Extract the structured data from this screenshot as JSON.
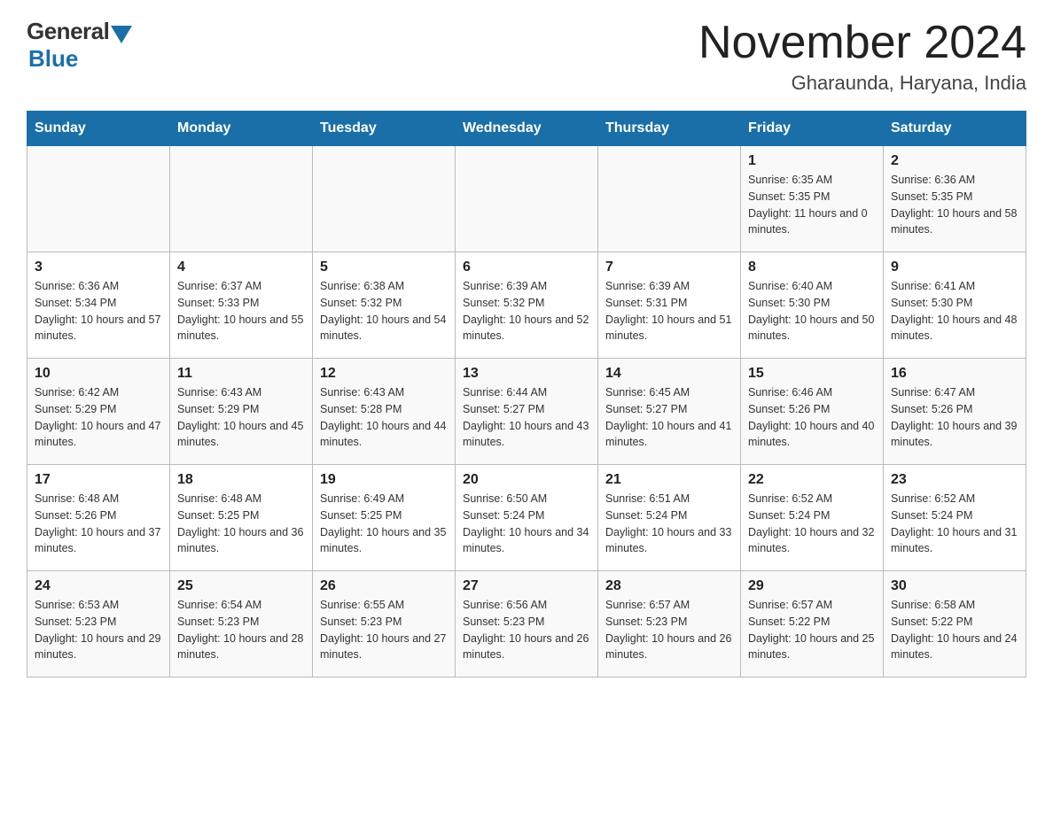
{
  "logo": {
    "general": "General",
    "blue": "Blue"
  },
  "title": "November 2024",
  "subtitle": "Gharaunda, Haryana, India",
  "headers": [
    "Sunday",
    "Monday",
    "Tuesday",
    "Wednesday",
    "Thursday",
    "Friday",
    "Saturday"
  ],
  "weeks": [
    [
      {
        "day": "",
        "info": ""
      },
      {
        "day": "",
        "info": ""
      },
      {
        "day": "",
        "info": ""
      },
      {
        "day": "",
        "info": ""
      },
      {
        "day": "",
        "info": ""
      },
      {
        "day": "1",
        "info": "Sunrise: 6:35 AM\nSunset: 5:35 PM\nDaylight: 11 hours and 0 minutes."
      },
      {
        "day": "2",
        "info": "Sunrise: 6:36 AM\nSunset: 5:35 PM\nDaylight: 10 hours and 58 minutes."
      }
    ],
    [
      {
        "day": "3",
        "info": "Sunrise: 6:36 AM\nSunset: 5:34 PM\nDaylight: 10 hours and 57 minutes."
      },
      {
        "day": "4",
        "info": "Sunrise: 6:37 AM\nSunset: 5:33 PM\nDaylight: 10 hours and 55 minutes."
      },
      {
        "day": "5",
        "info": "Sunrise: 6:38 AM\nSunset: 5:32 PM\nDaylight: 10 hours and 54 minutes."
      },
      {
        "day": "6",
        "info": "Sunrise: 6:39 AM\nSunset: 5:32 PM\nDaylight: 10 hours and 52 minutes."
      },
      {
        "day": "7",
        "info": "Sunrise: 6:39 AM\nSunset: 5:31 PM\nDaylight: 10 hours and 51 minutes."
      },
      {
        "day": "8",
        "info": "Sunrise: 6:40 AM\nSunset: 5:30 PM\nDaylight: 10 hours and 50 minutes."
      },
      {
        "day": "9",
        "info": "Sunrise: 6:41 AM\nSunset: 5:30 PM\nDaylight: 10 hours and 48 minutes."
      }
    ],
    [
      {
        "day": "10",
        "info": "Sunrise: 6:42 AM\nSunset: 5:29 PM\nDaylight: 10 hours and 47 minutes."
      },
      {
        "day": "11",
        "info": "Sunrise: 6:43 AM\nSunset: 5:29 PM\nDaylight: 10 hours and 45 minutes."
      },
      {
        "day": "12",
        "info": "Sunrise: 6:43 AM\nSunset: 5:28 PM\nDaylight: 10 hours and 44 minutes."
      },
      {
        "day": "13",
        "info": "Sunrise: 6:44 AM\nSunset: 5:27 PM\nDaylight: 10 hours and 43 minutes."
      },
      {
        "day": "14",
        "info": "Sunrise: 6:45 AM\nSunset: 5:27 PM\nDaylight: 10 hours and 41 minutes."
      },
      {
        "day": "15",
        "info": "Sunrise: 6:46 AM\nSunset: 5:26 PM\nDaylight: 10 hours and 40 minutes."
      },
      {
        "day": "16",
        "info": "Sunrise: 6:47 AM\nSunset: 5:26 PM\nDaylight: 10 hours and 39 minutes."
      }
    ],
    [
      {
        "day": "17",
        "info": "Sunrise: 6:48 AM\nSunset: 5:26 PM\nDaylight: 10 hours and 37 minutes."
      },
      {
        "day": "18",
        "info": "Sunrise: 6:48 AM\nSunset: 5:25 PM\nDaylight: 10 hours and 36 minutes."
      },
      {
        "day": "19",
        "info": "Sunrise: 6:49 AM\nSunset: 5:25 PM\nDaylight: 10 hours and 35 minutes."
      },
      {
        "day": "20",
        "info": "Sunrise: 6:50 AM\nSunset: 5:24 PM\nDaylight: 10 hours and 34 minutes."
      },
      {
        "day": "21",
        "info": "Sunrise: 6:51 AM\nSunset: 5:24 PM\nDaylight: 10 hours and 33 minutes."
      },
      {
        "day": "22",
        "info": "Sunrise: 6:52 AM\nSunset: 5:24 PM\nDaylight: 10 hours and 32 minutes."
      },
      {
        "day": "23",
        "info": "Sunrise: 6:52 AM\nSunset: 5:24 PM\nDaylight: 10 hours and 31 minutes."
      }
    ],
    [
      {
        "day": "24",
        "info": "Sunrise: 6:53 AM\nSunset: 5:23 PM\nDaylight: 10 hours and 29 minutes."
      },
      {
        "day": "25",
        "info": "Sunrise: 6:54 AM\nSunset: 5:23 PM\nDaylight: 10 hours and 28 minutes."
      },
      {
        "day": "26",
        "info": "Sunrise: 6:55 AM\nSunset: 5:23 PM\nDaylight: 10 hours and 27 minutes."
      },
      {
        "day": "27",
        "info": "Sunrise: 6:56 AM\nSunset: 5:23 PM\nDaylight: 10 hours and 26 minutes."
      },
      {
        "day": "28",
        "info": "Sunrise: 6:57 AM\nSunset: 5:23 PM\nDaylight: 10 hours and 26 minutes."
      },
      {
        "day": "29",
        "info": "Sunrise: 6:57 AM\nSunset: 5:22 PM\nDaylight: 10 hours and 25 minutes."
      },
      {
        "day": "30",
        "info": "Sunrise: 6:58 AM\nSunset: 5:22 PM\nDaylight: 10 hours and 24 minutes."
      }
    ]
  ]
}
